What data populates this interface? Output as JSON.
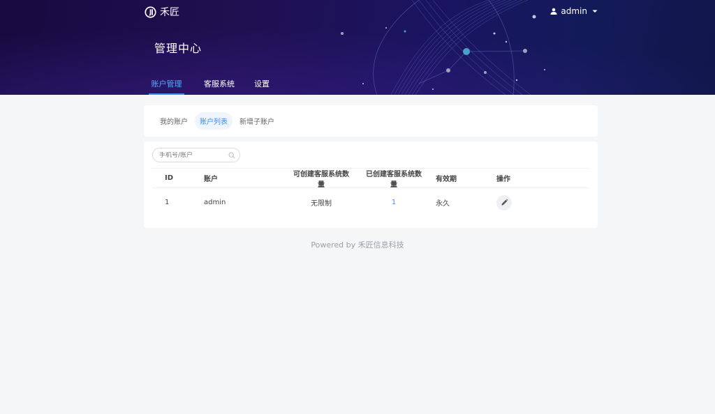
{
  "brand": {
    "name": "禾匠",
    "logo_icon": "brand-logo-icon"
  },
  "user": {
    "name": "admin",
    "icon": "user-icon",
    "caret": "caret-down-icon"
  },
  "page": {
    "title": "管理中心"
  },
  "nav": {
    "tabs": [
      {
        "label": "账户管理",
        "active": true
      },
      {
        "label": "客服系统",
        "active": false
      },
      {
        "label": "设置",
        "active": false
      }
    ]
  },
  "subtabs": {
    "items": [
      {
        "label": "我的账户",
        "active": false
      },
      {
        "label": "账户列表",
        "active": true
      },
      {
        "label": "新增子账户",
        "active": false
      }
    ]
  },
  "search": {
    "placeholder": "手机号/账户",
    "value": ""
  },
  "table": {
    "columns": {
      "id": "ID",
      "account": "账户",
      "can_create": "可创建客服系统数量",
      "created": "已创建客服系统数量",
      "expiry": "有效期",
      "actions": "操作"
    },
    "rows": [
      {
        "id": "1",
        "account": "admin",
        "can_create": "无限制",
        "created": "1",
        "expiry": "永久"
      }
    ]
  },
  "footer": {
    "text": "Powered by 禾匠信息科技"
  },
  "colors": {
    "accent": "#3b8cff",
    "banner_dark": "#170a3f",
    "background": "#f5f6f8"
  }
}
